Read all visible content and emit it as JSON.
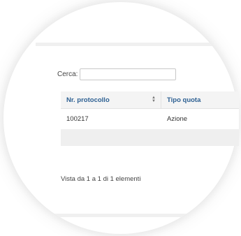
{
  "search": {
    "label": "Cerca:",
    "value": ""
  },
  "table": {
    "columns": [
      {
        "label": "Nr. protocollo"
      },
      {
        "label": "Tipo quota"
      }
    ],
    "rows": [
      {
        "protocollo": "100217",
        "tipo_quota": "Azione"
      }
    ]
  },
  "info": "Vista da 1 a 1 di 1 elementi",
  "icons": {
    "sort": "sort-arrows-icon"
  }
}
